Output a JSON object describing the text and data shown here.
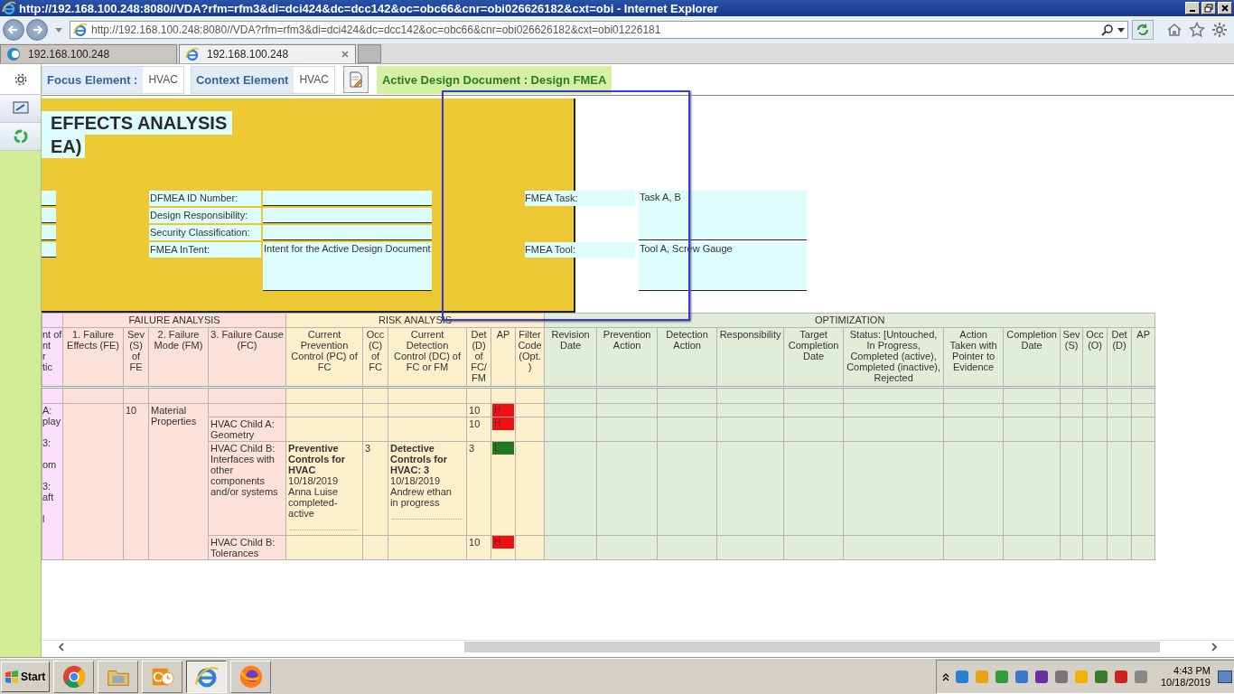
{
  "browser": {
    "title": "http://192.168.100.248:8080//VDA?rfm=rfm3&di=dci424&dc=dcc142&oc=obc66&cnr=obi026626182&cxt=obi - Internet Explorer",
    "url": "http://192.168.100.248:8080//VDA?rfm=rfm3&di=dci424&dc=dcc142&oc=obc66&cnr=obi026626182&cxt=obi01226181",
    "tabs": [
      {
        "label": "192.168.100.248",
        "selected": false
      },
      {
        "label": "192.168.100.248",
        "selected": true
      }
    ]
  },
  "toolbar": {
    "focus_label": "Focus Element :",
    "focus_value": "HVAC",
    "context_label": "Context Element",
    "context_value": "HVAC",
    "active_document": "Active Design Document : Design FMEA"
  },
  "form": {
    "title_lines": [
      "EFFECTS ANALYSIS",
      "EA)"
    ],
    "fields": [
      {
        "label": "DFMEA ID Number:"
      },
      {
        "label": "Design Responsibility:"
      },
      {
        "label": "Security Classification:"
      },
      {
        "label": "FMEA InTent:",
        "value": "Intent for the Active Design Document"
      }
    ],
    "side_fields": [
      {
        "label": "FMEA Task:",
        "value": "Task A, B"
      },
      {
        "label": "FMEA Tool:",
        "value": "Tool A, Screw Gauge"
      }
    ]
  },
  "table": {
    "groups": [
      {
        "kind": "cut",
        "columns": [
          {
            "label": "nt of\nnt\nr\ntic"
          }
        ]
      },
      {
        "kind": "failure",
        "label": "FAILURE ANALYSIS",
        "columns": [
          {
            "label": "1. Failure Effects (FE)"
          },
          {
            "label": "Sev (S) of FE"
          },
          {
            "label": "2. Failure Mode (FM)"
          },
          {
            "label": "3. Failure Cause (FC)"
          }
        ]
      },
      {
        "kind": "risk",
        "label": "RISK ANALYSIS",
        "columns": [
          {
            "label": "Current Prevention Control (PC) of FC"
          },
          {
            "label": "Occ (C) of FC"
          },
          {
            "label": "Current Detection Control (DC) of FC or FM"
          },
          {
            "label": "Det (D) of FC/FM"
          },
          {
            "label": "AP"
          },
          {
            "label": "Filter Code (Opt.)"
          }
        ]
      },
      {
        "kind": "optimization",
        "label": "OPTIMIZATION",
        "columns": [
          {
            "label": "Revision Date"
          },
          {
            "label": "Prevention Action"
          },
          {
            "label": "Detection Action"
          },
          {
            "label": "Responsibility"
          },
          {
            "label": "Target Completion Date"
          },
          {
            "label": "Status: [Untouched, In Progress, Completed (active), Completed (inactive), Rejected"
          },
          {
            "label": "Action Taken with Pointer to Evidence"
          },
          {
            "label": "Completion Date"
          },
          {
            "label": "Sev (S)"
          },
          {
            "label": "Occ (O)"
          },
          {
            "label": "Det (D)"
          },
          {
            "label": "AP"
          }
        ]
      }
    ],
    "rows": [
      {
        "cut_text": "A:\nplay\n\n3:\n\nom\n\n3:\naft\n\nl",
        "severity": "10",
        "mode": "Material Properties",
        "causes": [
          {
            "det": "10",
            "ap": {
              "label": "H",
              "color": "#ee1111"
            }
          },
          {
            "cause": "HVAC Child A: Geometry",
            "det": "10",
            "ap": {
              "label": "H",
              "color": "#ee1111"
            }
          },
          {
            "cause": "HVAC Child B: Interfaces with other components and/or systems",
            "prevention": {
              "title": "Preventive Controls for HVAC",
              "lines": [
                "10/18/2019",
                "Anna Luise",
                "completed-active"
              ]
            },
            "occurrence": "3",
            "detection": {
              "title": "Detective Controls for HVAC: 3",
              "lines": [
                "10/18/2019",
                "Andrew ethan",
                "in progress"
              ]
            },
            "det": "3",
            "ap": {
              "label": "L",
              "color": "#1e7a1e"
            }
          },
          {
            "cause": "HVAC Child B: Tolerances",
            "det": "10",
            "ap": {
              "label": "H",
              "color": "#ee1111"
            }
          }
        ]
      }
    ]
  },
  "taskbar": {
    "start_label": "Start",
    "clock_time": "4:43 PM",
    "clock_date": "10/18/2019"
  }
}
